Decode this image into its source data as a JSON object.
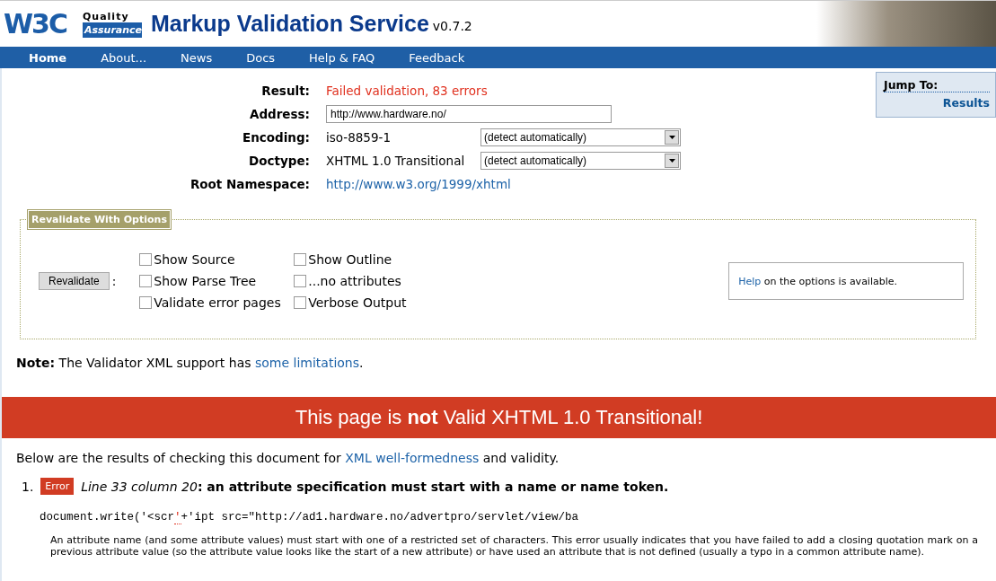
{
  "header": {
    "logo": "W3C",
    "qa_top": "Quality",
    "qa_bottom": "Assurance",
    "title": "Markup Validation Service",
    "version": "v0.7.2"
  },
  "nav": [
    {
      "label": "Home",
      "selected": true
    },
    {
      "label": "About...",
      "selected": false
    },
    {
      "label": "News",
      "selected": false
    },
    {
      "label": "Docs",
      "selected": false
    },
    {
      "label": "Help & FAQ",
      "selected": false
    },
    {
      "label": "Feedback",
      "selected": false
    }
  ],
  "jump_to": {
    "title": "Jump To:",
    "link": "Results"
  },
  "summary": [
    {
      "label": "Result:",
      "kind": "error",
      "value": "Failed validation, 83 errors"
    },
    {
      "label": "Address:",
      "kind": "input",
      "value": "http://www.hardware.no/"
    },
    {
      "label": "Encoding:",
      "kind": "select",
      "value": "iso-8859-1",
      "select": "(detect automatically)"
    },
    {
      "label": "Doctype:",
      "kind": "select",
      "value": "XHTML 1.0 Transitional",
      "select": "(detect automatically)"
    },
    {
      "label": "Root Namespace:",
      "kind": "link",
      "value": "http://www.w3.org/1999/xhtml"
    }
  ],
  "options": {
    "legend": "Revalidate With Options",
    "button": "Revalidate",
    "colon": ":",
    "checkboxes": [
      {
        "label": "Show Source",
        "checked": false
      },
      {
        "label": "Show Outline",
        "checked": false
      },
      {
        "label": "Show Parse Tree",
        "checked": false
      },
      {
        "label": "...no attributes",
        "checked": false
      },
      {
        "label": "Validate error pages",
        "checked": false
      },
      {
        "label": "Verbose Output",
        "checked": false
      }
    ],
    "help_link": "Help",
    "help_text": "on the options is available."
  },
  "note": {
    "label": "Note:",
    "text": "The Validator XML support has",
    "link": "some limitations",
    "end": "."
  },
  "banner": "This page is **not** Valid XHTML 1.0 Transitional!",
  "intro": {
    "text": "Below are the results of checking this document for",
    "link": "XML well-formedness",
    "end": "and validity."
  },
  "errors": [
    {
      "number": "1.",
      "badge": "Error",
      "location": "Line 33 column 20",
      "message": ": an attribute specification must start with a name or name token.",
      "code_before": "document.write('<scr",
      "code_mark": "'",
      "code_after": "+'ipt src=\"http://ad1.hardware.no/advertpro/servlet/view/ba",
      "explanation": "An attribute name (and some attribute values) must start with one of a restricted set of characters. This error usually indicates that you have failed to add a closing quotation mark on a previous attribute value (so the attribute value looks like the start of a new attribute) or have used an attribute that is not defined (usually a typo in a common attribute name)."
    }
  ]
}
